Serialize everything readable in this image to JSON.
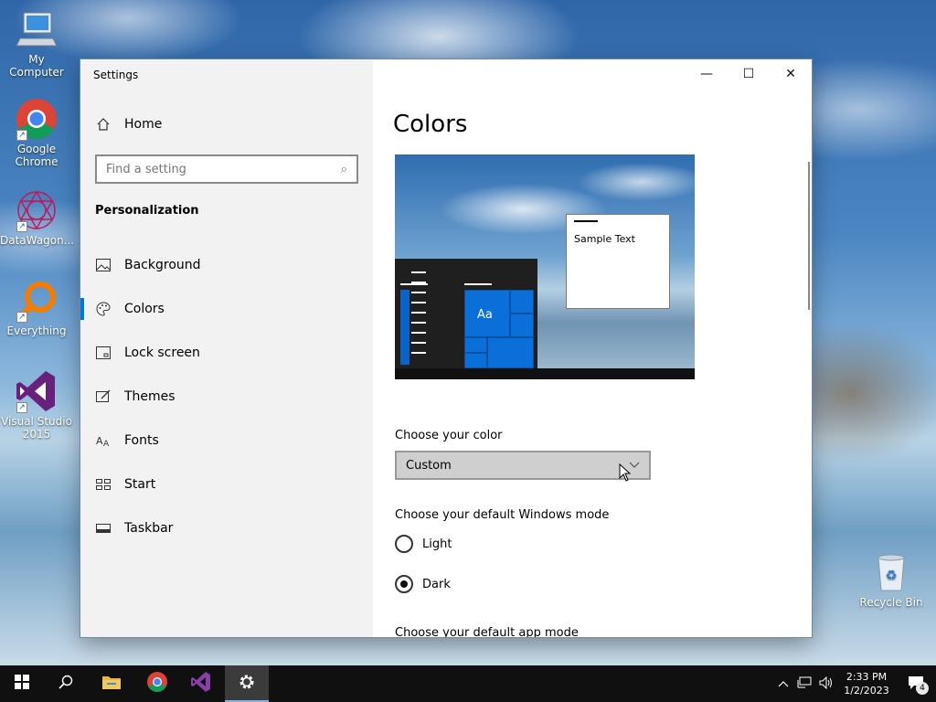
{
  "desktop": {
    "icons": [
      {
        "label": "My Computer"
      },
      {
        "label": "Google Chrome"
      },
      {
        "label": "DataWagon..."
      },
      {
        "label": "Everything"
      },
      {
        "label": "Visual Studio 2015"
      },
      {
        "label": "Recycle Bin"
      }
    ]
  },
  "window": {
    "title": "Settings",
    "minimize": "—",
    "maximize": "☐",
    "close": "✕"
  },
  "sidebar": {
    "home": "Home",
    "search_placeholder": "Find a setting",
    "section": "Personalization",
    "items": [
      {
        "label": "Background",
        "icon": "image-icon"
      },
      {
        "label": "Colors",
        "icon": "palette-icon",
        "selected": true
      },
      {
        "label": "Lock screen",
        "icon": "lock-screen-icon"
      },
      {
        "label": "Themes",
        "icon": "themes-icon"
      },
      {
        "label": "Fonts",
        "icon": "fonts-icon"
      },
      {
        "label": "Start",
        "icon": "start-icon"
      },
      {
        "label": "Taskbar",
        "icon": "taskbar-icon"
      }
    ]
  },
  "content": {
    "title": "Colors",
    "preview": {
      "sample_text": "Sample Text",
      "tile_text": "Aa"
    },
    "choose_color_label": "Choose your color",
    "choose_color_value": "Custom",
    "windows_mode_label": "Choose your default Windows mode",
    "windows_mode_options": [
      {
        "label": "Light",
        "checked": false
      },
      {
        "label": "Dark",
        "checked": true
      }
    ],
    "app_mode_label": "Choose your default app mode"
  },
  "taskbar": {
    "clock_time": "2:33 PM",
    "clock_date": "1/2/2023",
    "notification_count": "4"
  },
  "colors": {
    "accent": "#0078d7",
    "taskbar": "#101010",
    "sidebar": "#f2f2f2"
  }
}
